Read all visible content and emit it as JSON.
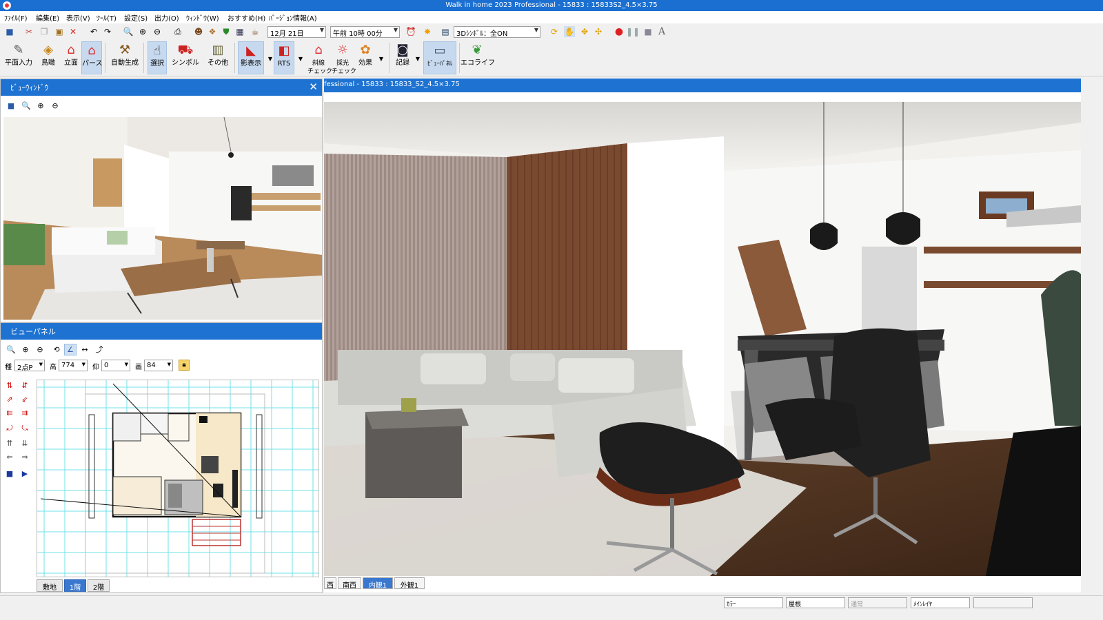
{
  "window": {
    "title": "Walk in home 2023 Professional - 15833 : 15833S2_4.5×3.75"
  },
  "menu": [
    "ﾌｧｲﾙ(F)",
    "編集(E)",
    "表示(V)",
    "ﾂｰﾙ(T)",
    "設定(S)",
    "出力(O)",
    "ｳｨﾝﾄﾞｳ(W)",
    "おすすめ(H)",
    "ﾊﾞｰｼﾞｮﾝ情報(A)"
  ],
  "toolbar": {
    "date": "12月 21日",
    "time": "午前 10時 00分",
    "symbol_mode": "3Dｼﾝﾎﾞﾙ：全ON",
    "font_glyph": "A"
  },
  "ribbon": {
    "plan_input": "平面入力",
    "birdseye": "鳥瞰",
    "elevation": "立面",
    "perspective": "パース",
    "auto_generate": "自動生成",
    "select": "選択",
    "symbol": "シンボル",
    "other": "その他",
    "shadow": "影表示",
    "rts": "RTS",
    "slope_check": "斜線\nチェック",
    "lighting_check": "採光\nチェック",
    "effects": "効果",
    "record": "記録",
    "view_panel": "ﾋﾞｭｰﾊﾟﾈﾙ",
    "ecolife": "エコライフ"
  },
  "preview_window": {
    "title": "ﾋﾞｭｰｳｨﾝﾄﾞｳ",
    "close": "✕"
  },
  "view_panel": {
    "title": "ビューパネル",
    "kind_label": "種",
    "kind_value": "2点P",
    "height_label": "高",
    "height_value": "774",
    "elev_label": "仰",
    "elev_value": "0",
    "angle_label": "画",
    "angle_value": "84",
    "floor_tabs": [
      "敷地",
      "1階",
      "2階"
    ],
    "active_floor": "1階"
  },
  "main_view": {
    "title": "fessional - 15833 : 15833_S2_4.5×3.75",
    "view_tabs": [
      "西",
      "南西",
      "内観1",
      "外観1"
    ],
    "active_tab": "内観1"
  },
  "statusbar": {
    "color": "ｶﾗｰ",
    "roof": "屋根",
    "normal": "通常",
    "main_layer": "ﾒｲﾝﾚｲﾔ"
  },
  "colors": {
    "title_blue": "#1a6fd1",
    "panel_blue": "#1e73d2",
    "active_tab": "#3a78d0",
    "record_red": "#e02020"
  }
}
